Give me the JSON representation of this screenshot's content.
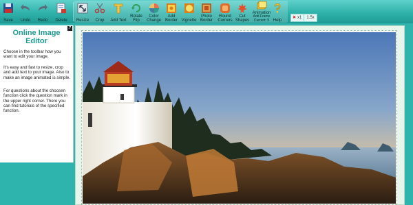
{
  "toolbar": {
    "save": "Save",
    "undo": "Undo",
    "redo": "Redo",
    "delete": "Delete",
    "resize": "Resize",
    "crop": "Crop",
    "add_text": "Add Text",
    "rotate_flip": "Rotate\nFlip",
    "color_change": "Color\nChange",
    "add_border": "Add\nBorder",
    "vignette": "Vignette",
    "photo_border": "Photo\nBorder",
    "round_corners": "Round\nCorners",
    "cut_shapes": "Cut\nShapes",
    "animation": "Animation",
    "add_frame": "Add Frame",
    "current": "Current:",
    "current_value": "5",
    "help": "Help",
    "zoom_value": "x1",
    "size_value": "1.5x"
  },
  "side": {
    "help_mark": "?",
    "title": "Online Image Editor",
    "p1": "Choose in the toolbar how you want to edit your image.",
    "p2": "It's easy and fast to resize, crop and add text to your image. Also to make an image animated is simple.",
    "p3": "For questions about the choosen function click the question mark in the upper right corner. There you can find tutorials of the specified function."
  }
}
